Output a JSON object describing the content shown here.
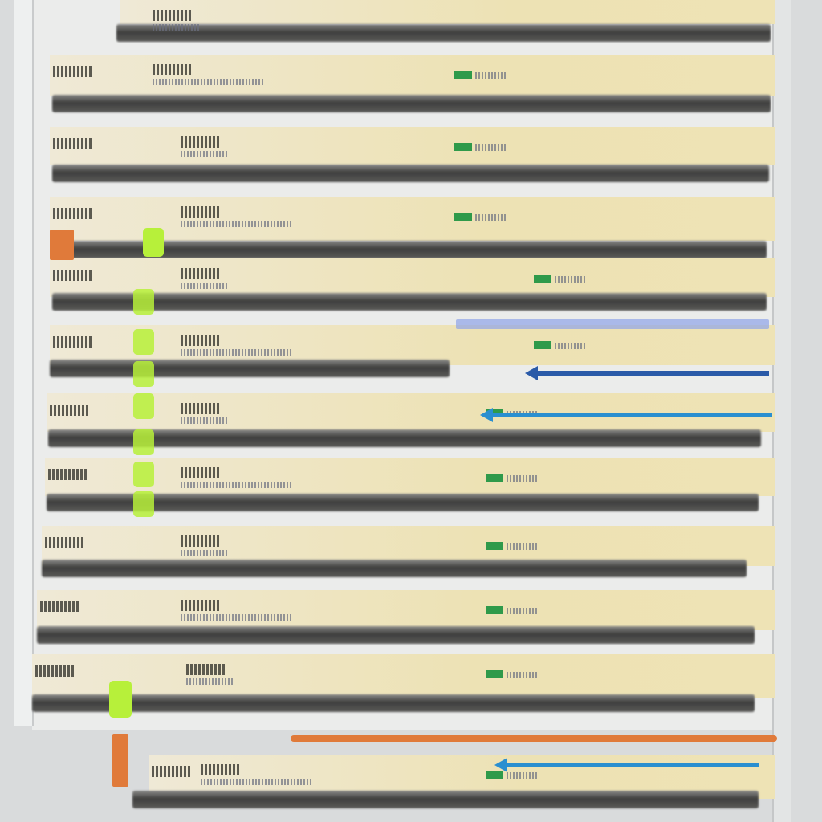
{
  "colors": {
    "accent_green": "#b7f03a",
    "accent_orange": "#e07a3a",
    "arrow_blue": "#2a8fd0",
    "arrow_navy": "#2a5aa8",
    "row_band": "#ede2b4",
    "row_bar": "#3f3f3e"
  },
  "list": {
    "rows": [
      {
        "status": false
      },
      {
        "status": true
      },
      {
        "status": true
      },
      {
        "status": true
      },
      {
        "status": true
      },
      {
        "status": true
      },
      {
        "status": true
      },
      {
        "status": true
      },
      {
        "status": true
      },
      {
        "status": true
      },
      {
        "status": true
      },
      {
        "status": true
      }
    ],
    "note": ""
  },
  "markers": [
    "green-handle",
    "orange-handle",
    "blue-arrow",
    "navy-arrow",
    "orange-line"
  ]
}
